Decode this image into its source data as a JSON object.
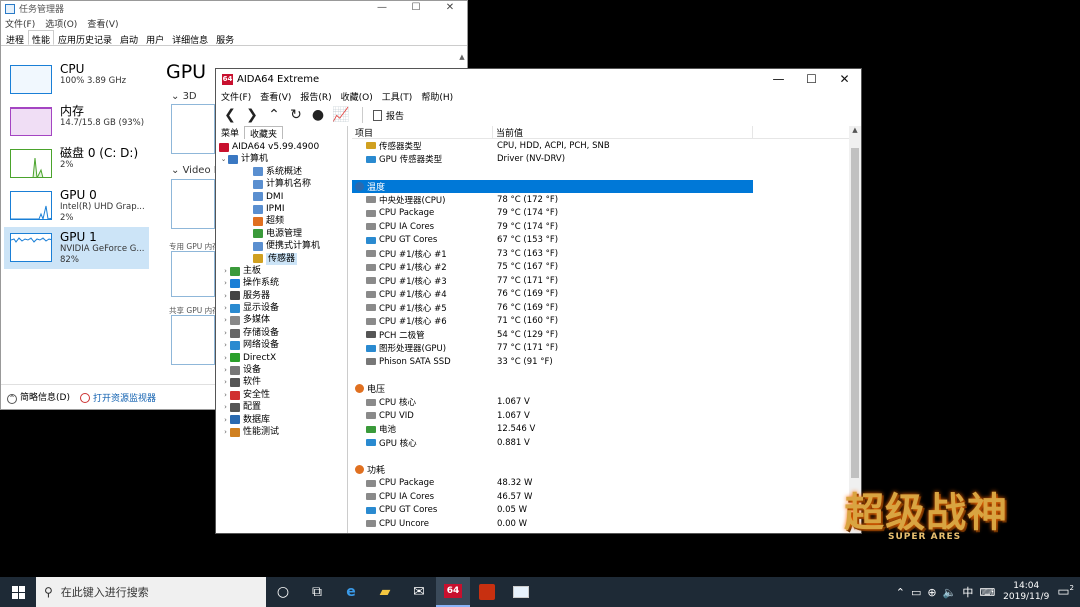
{
  "taskmgr": {
    "title": "任务管理器",
    "menu": [
      "文件(F)",
      "选项(O)",
      "查看(V)"
    ],
    "tabs": [
      "进程",
      "性能",
      "应用历史记录",
      "启动",
      "用户",
      "详细信息",
      "服务"
    ],
    "active_tab": "性能",
    "items": [
      {
        "name": "CPU",
        "sub1": "100% 3.89 GHz",
        "sub2": "",
        "color": "#1a7fd6"
      },
      {
        "name": "内存",
        "sub1": "14.7/15.8 GB (93%)",
        "sub2": "",
        "color": "#a445c2"
      },
      {
        "name": "磁盘 0 (C: D:)",
        "sub1": "2%",
        "sub2": "",
        "color": "#4aa32c"
      },
      {
        "name": "GPU 0",
        "sub1": "Intel(R) UHD Grap...",
        "sub2": "2%",
        "color": "#1a7fd6"
      },
      {
        "name": "GPU 1",
        "sub1": "NVIDIA GeForce G...",
        "sub2": "82%",
        "color": "#1a7fd6"
      }
    ],
    "heading": "GPU",
    "sub3d": "3D",
    "video": "Video Er",
    "label_dedicated": "专用 GPU 内存",
    "label_shared": "共享 GPU 内存",
    "footer_brief": "简略信息(D)",
    "footer_link": "打开资源监视器"
  },
  "aida": {
    "title": "AIDA64 Extreme",
    "menu": [
      "文件(F)",
      "查看(V)",
      "报告(R)",
      "收藏(O)",
      "工具(T)",
      "帮助(H)"
    ],
    "toolbar_report": "报告",
    "left_tabs": [
      "菜单",
      "收藏夹"
    ],
    "tree": [
      {
        "label": "AIDA64 v5.99.4900",
        "level": 0,
        "arrow": "",
        "color": "#c8102e"
      },
      {
        "label": "计算机",
        "level": 0,
        "arrow": "v",
        "color": "#3a78c2"
      },
      {
        "label": "系统概述",
        "level": 2,
        "arrow": "",
        "color": "#5a8fd0"
      },
      {
        "label": "计算机名称",
        "level": 2,
        "arrow": "",
        "color": "#5a8fd0"
      },
      {
        "label": "DMI",
        "level": 2,
        "arrow": "",
        "color": "#5a8fd0"
      },
      {
        "label": "IPMI",
        "level": 2,
        "arrow": "",
        "color": "#5a8fd0"
      },
      {
        "label": "超频",
        "level": 2,
        "arrow": "",
        "color": "#e07020"
      },
      {
        "label": "电源管理",
        "level": 2,
        "arrow": "",
        "color": "#3a9a3a"
      },
      {
        "label": "便携式计算机",
        "level": 2,
        "arrow": "",
        "color": "#5a8fd0"
      },
      {
        "label": "传感器",
        "level": 2,
        "arrow": "",
        "color": "#d0a020",
        "selected": true
      },
      {
        "label": "主板",
        "level": 1,
        "arrow": ">",
        "color": "#3a9a3a"
      },
      {
        "label": "操作系统",
        "level": 1,
        "arrow": ">",
        "color": "#1a7fd6"
      },
      {
        "label": "服务器",
        "level": 1,
        "arrow": ">",
        "color": "#444444"
      },
      {
        "label": "显示设备",
        "level": 1,
        "arrow": ">",
        "color": "#2a8ad0"
      },
      {
        "label": "多媒体",
        "level": 1,
        "arrow": ">",
        "color": "#888888"
      },
      {
        "label": "存储设备",
        "level": 1,
        "arrow": ">",
        "color": "#666666"
      },
      {
        "label": "网络设备",
        "level": 1,
        "arrow": ">",
        "color": "#2a8ad0"
      },
      {
        "label": "DirectX",
        "level": 1,
        "arrow": ">",
        "color": "#2aa02a"
      },
      {
        "label": "设备",
        "level": 1,
        "arrow": ">",
        "color": "#777777"
      },
      {
        "label": "软件",
        "level": 1,
        "arrow": ">",
        "color": "#555555"
      },
      {
        "label": "安全性",
        "level": 1,
        "arrow": ">",
        "color": "#d03030"
      },
      {
        "label": "配置",
        "level": 1,
        "arrow": ">",
        "color": "#555555"
      },
      {
        "label": "数据库",
        "level": 1,
        "arrow": ">",
        "color": "#2a6ab0"
      },
      {
        "label": "性能测试",
        "level": 1,
        "arrow": ">",
        "color": "#d08020"
      }
    ],
    "col_item": "项目",
    "col_value": "当前值",
    "top_rows": [
      {
        "item": "传感器类型",
        "value": "CPU, HDD, ACPI, PCH, SNB",
        "color": "#d0a020"
      },
      {
        "item": "GPU 传感器类型",
        "value": "Driver  (NV-DRV)",
        "color": "#2a8ad0"
      }
    ],
    "sections": [
      {
        "title": "温度",
        "selected": true,
        "color": "#2a6ab0",
        "rows": [
          {
            "item": "中央处理器(CPU)",
            "value": "78 °C  (172 °F)",
            "color": "#8a8a8a"
          },
          {
            "item": "CPU Package",
            "value": "79 °C  (174 °F)",
            "color": "#8a8a8a"
          },
          {
            "item": "CPU IA Cores",
            "value": "79 °C  (174 °F)",
            "color": "#8a8a8a"
          },
          {
            "item": "CPU GT Cores",
            "value": "67 °C  (153 °F)",
            "color": "#2a8ad0"
          },
          {
            "item": "CPU #1/核心 #1",
            "value": "73 °C  (163 °F)",
            "color": "#8a8a8a"
          },
          {
            "item": "CPU #1/核心 #2",
            "value": "75 °C  (167 °F)",
            "color": "#8a8a8a"
          },
          {
            "item": "CPU #1/核心 #3",
            "value": "77 °C  (171 °F)",
            "color": "#8a8a8a"
          },
          {
            "item": "CPU #1/核心 #4",
            "value": "76 °C  (169 °F)",
            "color": "#8a8a8a"
          },
          {
            "item": "CPU #1/核心 #5",
            "value": "76 °C  (169 °F)",
            "color": "#8a8a8a"
          },
          {
            "item": "CPU #1/核心 #6",
            "value": "71 °C  (160 °F)",
            "color": "#8a8a8a"
          },
          {
            "item": "PCH 二极管",
            "value": "54 °C  (129 °F)",
            "color": "#555555"
          },
          {
            "item": "图形处理器(GPU)",
            "value": "77 °C  (171 °F)",
            "color": "#2a8ad0"
          },
          {
            "item": "Phison SATA SSD",
            "value": "33 °C  (91 °F)",
            "color": "#777777"
          }
        ]
      },
      {
        "title": "电压",
        "selected": false,
        "color": "#e07020",
        "rows": [
          {
            "item": "CPU 核心",
            "value": "1.067 V",
            "color": "#8a8a8a"
          },
          {
            "item": "CPU VID",
            "value": "1.067 V",
            "color": "#8a8a8a"
          },
          {
            "item": "电池",
            "value": "12.546 V",
            "color": "#3a9a3a"
          },
          {
            "item": "GPU 核心",
            "value": "0.881 V",
            "color": "#2a8ad0"
          }
        ]
      },
      {
        "title": "功耗",
        "selected": false,
        "color": "#e07020",
        "rows": [
          {
            "item": "CPU Package",
            "value": "48.32 W",
            "color": "#8a8a8a"
          },
          {
            "item": "CPU IA Cores",
            "value": "46.57 W",
            "color": "#8a8a8a"
          },
          {
            "item": "CPU GT Cores",
            "value": "0.05 W",
            "color": "#2a8ad0"
          },
          {
            "item": "CPU Uncore",
            "value": "0.00 W",
            "color": "#8a8a8a"
          }
        ]
      }
    ]
  },
  "game": {
    "title": "超级战神",
    "subtitle": "SUPER ARES"
  },
  "taskbar": {
    "search_placeholder": "在此键入进行搜索",
    "tray_lang": "中",
    "time": "14:04",
    "date": "2019/11/9",
    "notif_count": "2"
  }
}
